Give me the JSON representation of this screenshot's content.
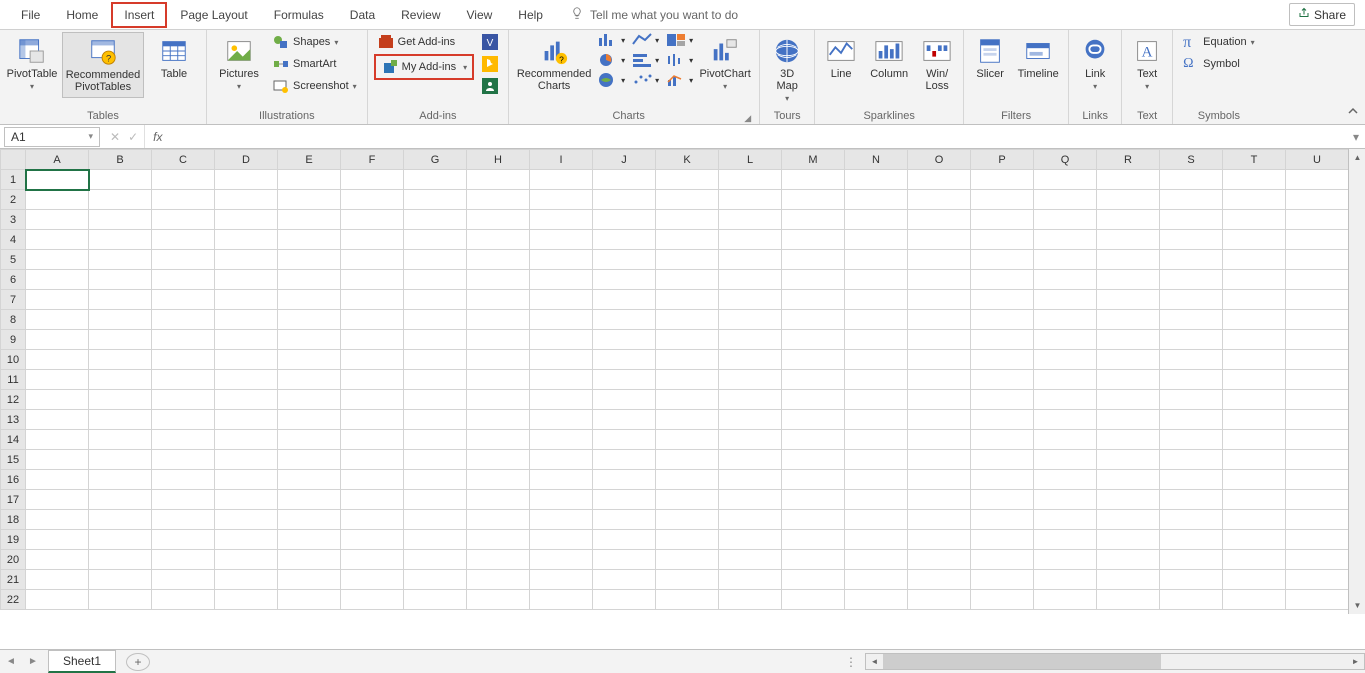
{
  "tabs": {
    "file": "File",
    "home": "Home",
    "insert": "Insert",
    "page_layout": "Page Layout",
    "formulas": "Formulas",
    "data": "Data",
    "review": "Review",
    "view": "View",
    "help": "Help",
    "tell_me": "Tell me what you want to do"
  },
  "share": "Share",
  "ribbon": {
    "tables": {
      "pivot": "PivotTable",
      "rec_pivot": "Recommended PivotTables",
      "table": "Table",
      "group": "Tables"
    },
    "illustrations": {
      "pictures": "Pictures",
      "shapes": "Shapes",
      "smartart": "SmartArt",
      "screenshot": "Screenshot",
      "group": "Illustrations"
    },
    "addins": {
      "get": "Get Add-ins",
      "my": "My Add-ins",
      "group": "Add-ins"
    },
    "charts": {
      "recommended": "Recommended Charts",
      "pivotchart": "PivotChart",
      "group": "Charts"
    },
    "tours": {
      "map": "3D Map",
      "group": "Tours"
    },
    "sparklines": {
      "line": "Line",
      "column": "Column",
      "winloss": "Win/ Loss",
      "group": "Sparklines"
    },
    "filters": {
      "slicer": "Slicer",
      "timeline": "Timeline",
      "group": "Filters"
    },
    "links": {
      "link": "Link",
      "group": "Links"
    },
    "text": {
      "text": "Text",
      "group": "Text"
    },
    "symbols": {
      "equation": "Equation",
      "symbol": "Symbol",
      "group": "Symbols"
    }
  },
  "namebox": "A1",
  "columns": [
    "A",
    "B",
    "C",
    "D",
    "E",
    "F",
    "G",
    "H",
    "I",
    "J",
    "K",
    "L",
    "M",
    "N",
    "O",
    "P",
    "Q",
    "R",
    "S",
    "T",
    "U"
  ],
  "rows": [
    1,
    2,
    3,
    4,
    5,
    6,
    7,
    8,
    9,
    10,
    11,
    12,
    13,
    14,
    15,
    16,
    17,
    18,
    19,
    20,
    21,
    22
  ],
  "sheet_tab": "Sheet1"
}
